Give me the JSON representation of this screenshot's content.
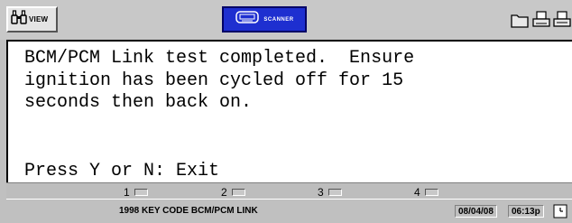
{
  "toolbar": {
    "view_label": "VIEW",
    "scanner_label": "SCANNER",
    "icons": [
      "view-binoculars-icon",
      "scanner-icon",
      "folder-icon",
      "print-icon",
      "print-icon"
    ]
  },
  "screen": {
    "lines": [
      "BCM/PCM Link test completed.  Ensure",
      "ignition has been cycled off for 15",
      "seconds then back on.",
      "Press Y or N: Exit"
    ]
  },
  "function_keys": [
    {
      "label": "1"
    },
    {
      "label": "2"
    },
    {
      "label": "3"
    },
    {
      "label": "4"
    }
  ],
  "status": {
    "title": "1998 KEY CODE BCM/PCM LINK",
    "date": "08/04/08",
    "time": "06:13p"
  },
  "colors": {
    "scanner_button": "#1e2fd0",
    "background": "#c0c0c0"
  }
}
